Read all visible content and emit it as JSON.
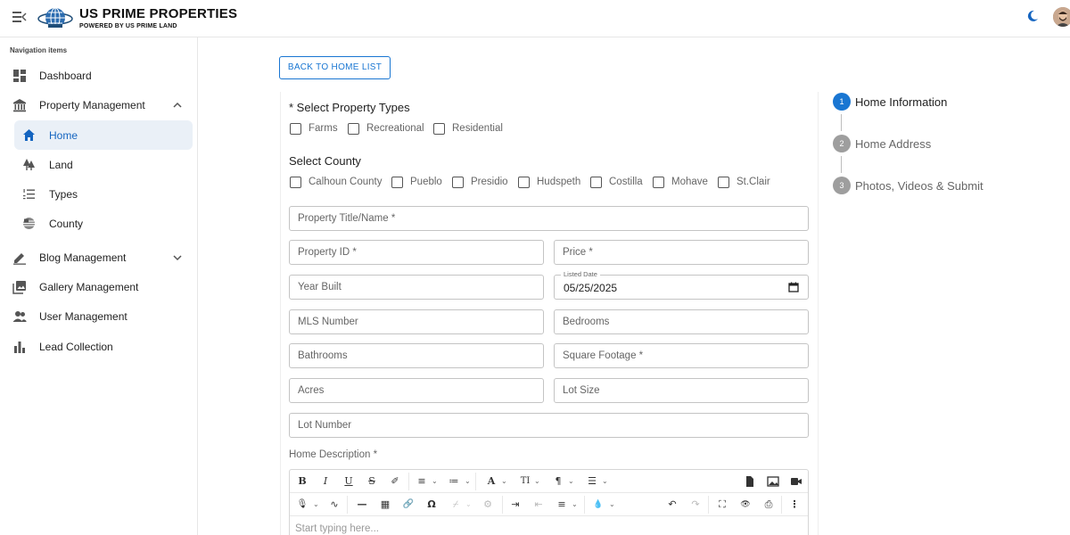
{
  "brand": {
    "title": "US PRIME PROPERTIES",
    "subtitle": "POWERED BY US PRIME LAND"
  },
  "sidebar": {
    "heading": "Navigation items",
    "items": [
      {
        "label": "Dashboard",
        "icon": "dashboard-icon"
      },
      {
        "label": "Property Management",
        "icon": "bank-icon",
        "expanded": true
      },
      {
        "label": "Blog Management",
        "icon": "edit-icon",
        "expanded": false
      },
      {
        "label": "Gallery Management",
        "icon": "gallery-icon"
      },
      {
        "label": "User Management",
        "icon": "users-icon"
      },
      {
        "label": "Lead Collection",
        "icon": "bar-chart-icon"
      }
    ],
    "sub_items": [
      {
        "label": "Home",
        "icon": "home-icon",
        "active": true
      },
      {
        "label": "Land",
        "icon": "forest-icon"
      },
      {
        "label": "Types",
        "icon": "list-numbered-icon"
      },
      {
        "label": "County",
        "icon": "flag-globe-icon"
      }
    ]
  },
  "main": {
    "back_button": "BACK TO HOME LIST",
    "property_types": {
      "title": "* Select Property Types",
      "options": [
        "Farms",
        "Recreational",
        "Residential"
      ]
    },
    "county": {
      "title": "Select County",
      "options": [
        "Calhoun County",
        "Pueblo",
        "Presidio",
        "Hudspeth",
        "Costilla",
        "Mohave",
        "St.Clair"
      ]
    },
    "fields": {
      "property_title": "Property Title/Name *",
      "property_id": "Property ID *",
      "price": "Price *",
      "year_built": "Year Built",
      "listed_date_label": "Listed Date",
      "listed_date_value": "05/25/2025",
      "mls_number": "MLS Number",
      "bedrooms": "Bedrooms",
      "bathrooms": "Bathrooms",
      "square_footage": "Square Footage *",
      "acres": "Acres",
      "lot_size": "Lot Size",
      "lot_number": "Lot Number"
    },
    "description": {
      "label": "Home Description *",
      "placeholder": "Start typing here..."
    },
    "toolbar_row1": [
      "B",
      "I",
      "U",
      "S",
      "✐",
      "≡",
      "≔",
      "A",
      "TI",
      "¶",
      "☰"
    ],
    "toolbar_row2": [
      "🎙",
      "∿",
      "—",
      "▦",
      "🔗",
      "Ω",
      "⌿",
      "⚙",
      "⇥",
      "⇤",
      "≡",
      "💧",
      "↶",
      "↷",
      "⛶",
      "👁",
      "⎙",
      "⋮"
    ]
  },
  "stepper": {
    "steps": [
      {
        "number": "1",
        "label": "Home Information",
        "active": true
      },
      {
        "number": "2",
        "label": "Home Address",
        "active": false
      },
      {
        "number": "3",
        "label": "Photos, Videos & Submit",
        "active": false
      }
    ]
  },
  "colors": {
    "primary": "#1976d2",
    "active_bg": "#eaf0f7",
    "inactive_step": "#9e9e9e"
  }
}
